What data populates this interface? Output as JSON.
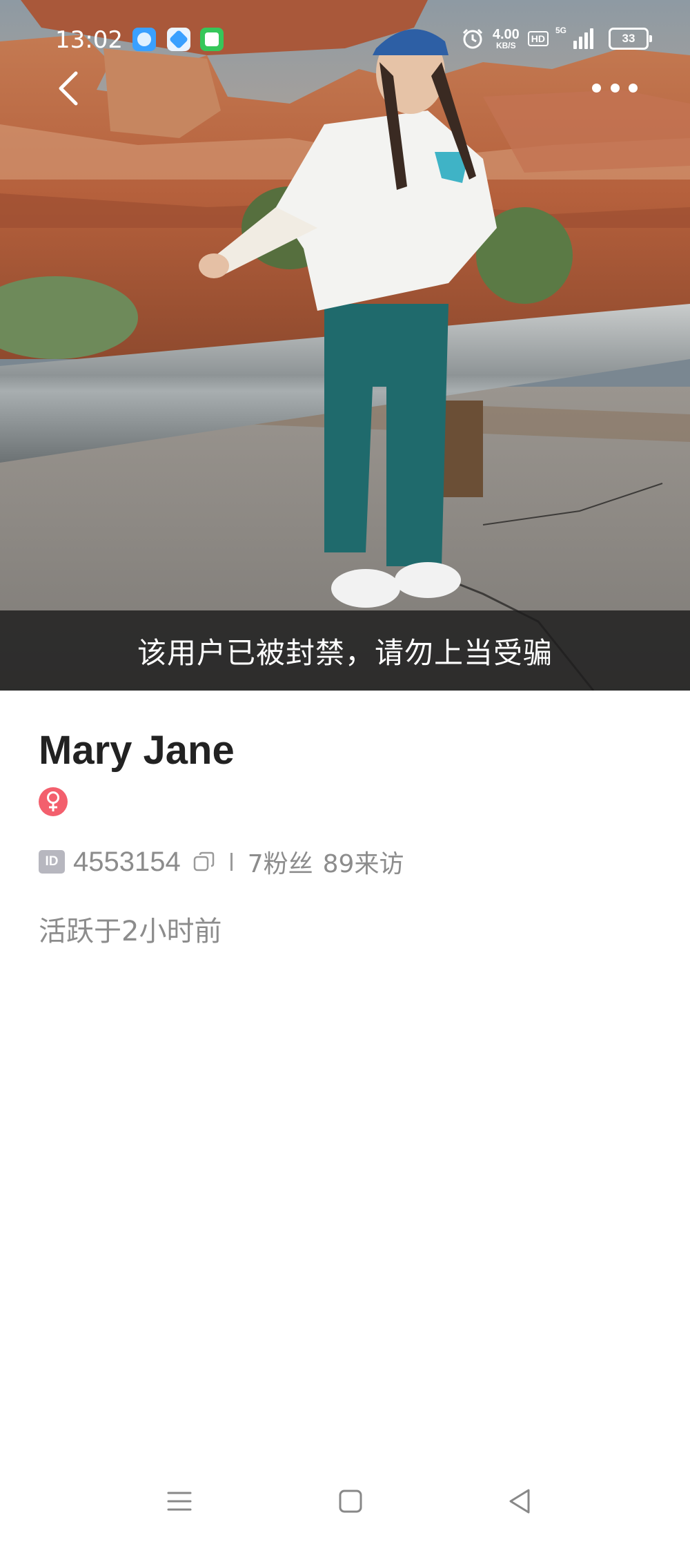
{
  "status_bar": {
    "time": "13:02",
    "net_speed_value": "4.00",
    "net_speed_unit": "KB/S",
    "hd_label": "HD",
    "network_type": "5G",
    "battery_level": "33",
    "notification_icons": [
      "bird-app-icon",
      "cloud-app-icon",
      "message-app-icon"
    ]
  },
  "header": {
    "back_icon": "chevron-left-icon",
    "more_icon": "more-dots-icon"
  },
  "banner": {
    "text": "该用户已被封禁，请勿上当受骗"
  },
  "profile": {
    "name": "Mary Jane",
    "gender_symbol": "♀",
    "gender_color": "#f35f6d",
    "id_badge": "ID",
    "id_value": "4553154",
    "separator": "|",
    "followers": "7粉丝",
    "visits": "89来访",
    "active_status": "活跃于2小时前"
  },
  "system_nav": {
    "menu_icon": "menu-lines-icon",
    "home_icon": "home-square-icon",
    "back_icon": "back-triangle-icon"
  }
}
